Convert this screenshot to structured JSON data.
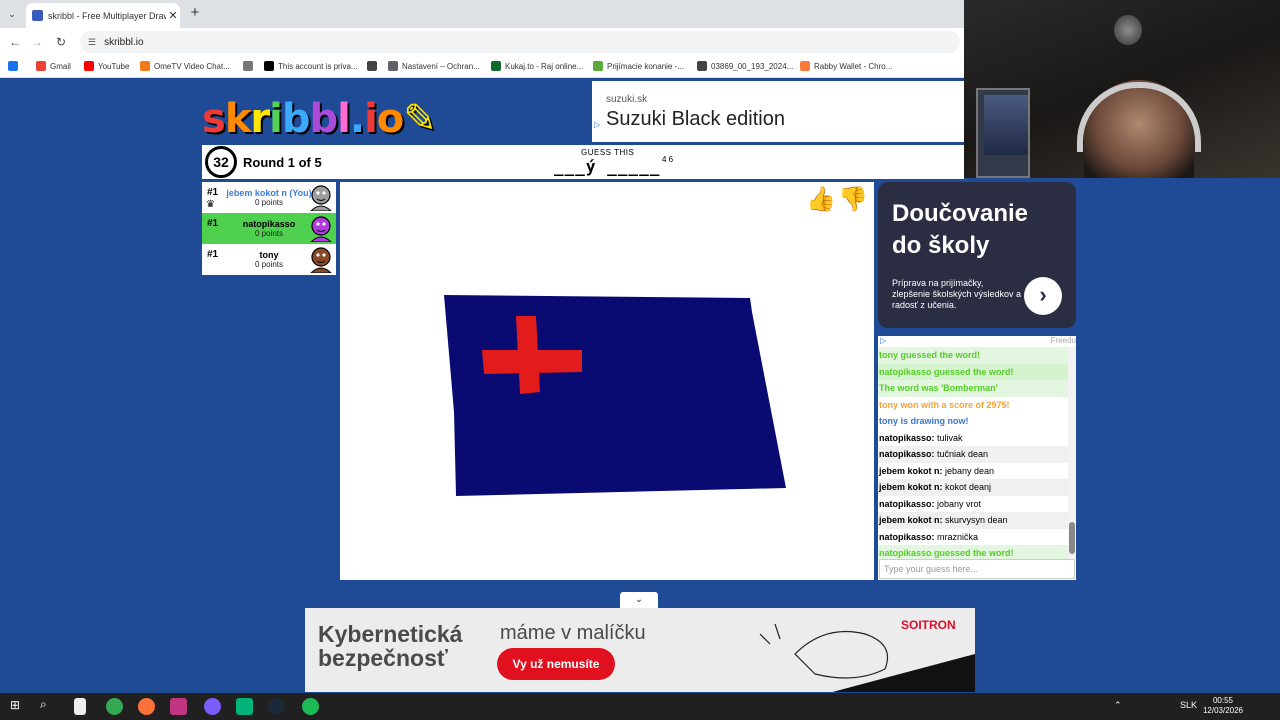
{
  "browser": {
    "tab_title": "skribbl - Free Multiplayer Drawi",
    "tab_close": "✕",
    "new_tab": "+",
    "tab_menu": "⌄",
    "url": "skribbl.io",
    "bookmarks": [
      {
        "label": "Gmail",
        "color": "#ea4335"
      },
      {
        "label": "YouTube",
        "color": "#ff0000"
      },
      {
        "label": "OmeTV Video Chat...",
        "color": "#f27a1a"
      },
      {
        "label": "",
        "color": "#777777"
      },
      {
        "label": "This account is priva...",
        "color": "#000000"
      },
      {
        "label": "",
        "color": "#444444"
      },
      {
        "label": "Nastavení – Ochran...",
        "color": "#5f6368"
      },
      {
        "label": "Kukaj.to - Raj online...",
        "color": "#0f6b2a"
      },
      {
        "label": "Prijímacie konanie -...",
        "color": "#5aa93a"
      },
      {
        "label": "03869_00_193_2024...",
        "color": "#444444"
      },
      {
        "label": "Rabby Wallet - Chro...",
        "color": "#ff7a3a"
      }
    ]
  },
  "ad_top": {
    "domain": "suzuki.sk",
    "title": "Suzuki Black edition",
    "ad_marker": "▷"
  },
  "game": {
    "timer": "32",
    "round": "Round 1 of 5",
    "guess_label": "GUESS THIS",
    "word_hint": "___ý _____",
    "word_lengths": "4 6"
  },
  "players": [
    {
      "rank": "#1",
      "name": "jebem kokot n (You)",
      "points": "0 points",
      "me": true,
      "guessed": false,
      "owner": true,
      "avatar_color": "#9e9e9e"
    },
    {
      "rank": "#1",
      "name": "natopikasso",
      "points": "0 points",
      "me": false,
      "guessed": true,
      "owner": false,
      "avatar_color": "#b13be0"
    },
    {
      "rank": "#1",
      "name": "tony",
      "points": "0 points",
      "me": false,
      "guessed": false,
      "owner": false,
      "avatar_color": "#8a4a28"
    }
  ],
  "drawing": {
    "background": "#ffffff",
    "flag_color": "#0a0a73",
    "cross_color": "#e21b1b"
  },
  "ad_right": {
    "headline_line1": "Doučovanie",
    "headline_line2": "do školy",
    "body": "Príprava na prijímačky, zlepšenie školských výsledkov a radosť z učenia.",
    "arrow": "›",
    "ad_marker": "▷",
    "advertiser": "Freedu"
  },
  "chat": {
    "messages": [
      {
        "style": "green",
        "author": "",
        "text": "tony guessed the word!"
      },
      {
        "style": "green b",
        "author": "",
        "text": "natopikasso guessed the word!"
      },
      {
        "style": "green",
        "author": "",
        "text": "The word was 'Bomberman'"
      },
      {
        "style": "orange",
        "author": "",
        "text": "tony won with a score of 2975!"
      },
      {
        "style": "blue",
        "author": "",
        "text": "tony is drawing now!"
      },
      {
        "style": "",
        "author": "natopikasso:",
        "text": " tulivak"
      },
      {
        "style": "alt",
        "author": "natopikasso:",
        "text": " tučniak dean"
      },
      {
        "style": "",
        "author": "jebem kokot n:",
        "text": " jebany dean"
      },
      {
        "style": "alt",
        "author": "jebem kokot n:",
        "text": " kokot deanj"
      },
      {
        "style": "",
        "author": "natopikasso:",
        "text": " jobany vrot"
      },
      {
        "style": "alt",
        "author": "jebem kokot n:",
        "text": " skurvysyn dean"
      },
      {
        "style": "",
        "author": "natopikasso:",
        "text": " mraznička"
      },
      {
        "style": "green",
        "author": "",
        "text": "natopikasso guessed the word!"
      }
    ],
    "input_placeholder": "Type your guess here..."
  },
  "ad_bottom": {
    "headline": "Kybernetická bezpečnosť",
    "sub": "máme v malíčku",
    "cta": "Vy už nemusíte",
    "brand": "SOITRON",
    "collapse": "⌄"
  },
  "taskbar": {
    "lang": "SLK",
    "time": "00:55",
    "date": "12/03/2026"
  }
}
